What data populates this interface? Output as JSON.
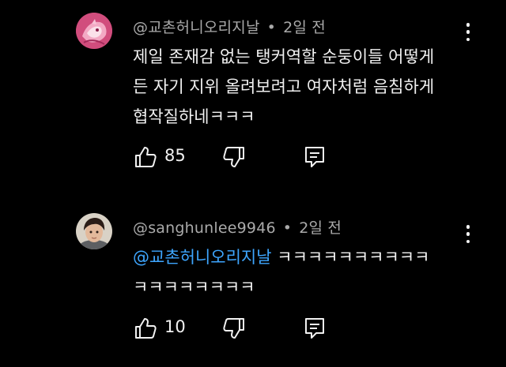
{
  "comments": [
    {
      "author": "@교촌허니오리지날",
      "separator": "•",
      "time": "2일 전",
      "mention": "",
      "text_lines": [
        "제일 존재감 없는 탱커역할 순둥이들 어떻게",
        "든 자기 지위 올려보려고 여자처럼 음침하게",
        "협작질하네ㅋㅋㅋ"
      ],
      "likes": "85",
      "avatar_icon": "pink-illustration-avatar"
    },
    {
      "author": "@sanghunlee9946",
      "separator": "•",
      "time": "2일 전",
      "mention": "@교촌허니오리지날",
      "text_lines": [
        "ㅋㅋㅋㅋㅋㅋㅋㅋㅋㅋ",
        "ㅋㅋㅋㅋㅋㅋㅋㅋ"
      ],
      "likes": "10",
      "avatar_icon": "person-photo-avatar"
    }
  ],
  "colors": {
    "background": "#000000",
    "text": "#f1f1f1",
    "meta": "#aaaaaa",
    "mention": "#3ea6ff"
  },
  "icons": {
    "like": "thumbs-up-icon",
    "dislike": "thumbs-down-icon",
    "reply": "reply-comment-icon",
    "more": "more-vert-icon"
  }
}
